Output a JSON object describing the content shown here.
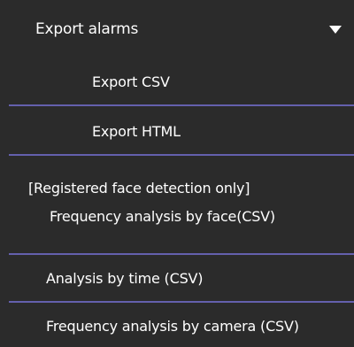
{
  "menu": {
    "header_label": "Export alarms",
    "items": [
      {
        "label": "Export CSV"
      },
      {
        "label": "Export HTML"
      },
      {
        "label_line1": "[Registered face detection only]",
        "label_line2": "Frequency analysis by face(CSV)"
      },
      {
        "label": "Analysis by time (CSV)"
      },
      {
        "label": "Frequency analysis by camera (CSV)"
      }
    ]
  },
  "colors": {
    "background": "#2b2b2b",
    "divider": "#6460ad",
    "text": "#ffffff"
  },
  "icons": {
    "dropdown": "caret-down-icon"
  }
}
